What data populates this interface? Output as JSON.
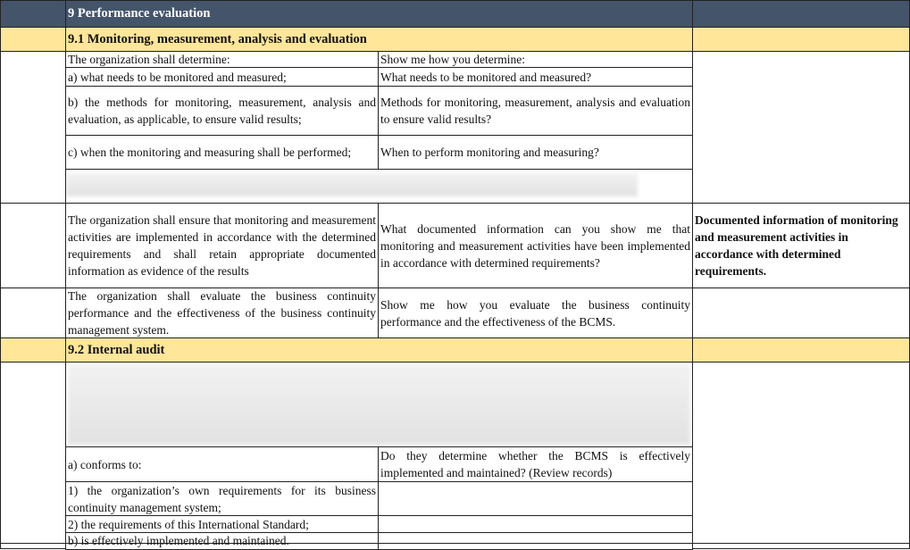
{
  "section": {
    "title": "9 Performance evaluation"
  },
  "s91": {
    "title": "9.1 Monitoring, measurement, analysis and evaluation",
    "rows": [
      {
        "req": "The organization shall determine:",
        "q": "Show me how you determine:"
      },
      {
        "req": "a) what needs to be monitored and measured;",
        "q": "What needs to be monitored and measured?"
      },
      {
        "req": "b) the methods for monitoring, measurement, analysis and evaluation, as applicable, to ensure valid results;",
        "q": "Methods for monitoring, measurement, analysis and evaluation to ensure valid results?"
      },
      {
        "req": "c) when the monitoring and measuring shall be performed;",
        "q": "When to perform monitoring and measuring?"
      },
      {
        "req": "The organization shall ensure that monitoring and measurement activities are implemented in accordance with the determined requirements and shall retain appropriate documented information as evidence of the results",
        "q": "What documented information can you show me that monitoring and measurement activities have been implemented in accordance with determined requirements?",
        "evidence": "Documented information of monitoring and measurement activities in accordance with determined requirements."
      },
      {
        "req": "The organization shall evaluate the business continuity performance and the effectiveness of the business continuity management system.",
        "q": "Show me how you evaluate the business continuity performance and the effectiveness of the BCMS."
      }
    ]
  },
  "s92": {
    "title": "9.2 Internal audit",
    "rows": [
      {
        "req": "a) conforms to:",
        "q": "Do they determine whether the BCMS is effectively implemented and maintained? (Review records)"
      },
      {
        "req": "1) the organization’s own requirements for its business continuity management system;",
        "q": ""
      },
      {
        "req": "2) the requirements of this International Standard;",
        "q": ""
      },
      {
        "req": "b) is effectively implemented and maintained.",
        "q": ""
      }
    ]
  },
  "colors": {
    "header_dark": "#44546a",
    "subheader_yellow": "#ffe699"
  }
}
